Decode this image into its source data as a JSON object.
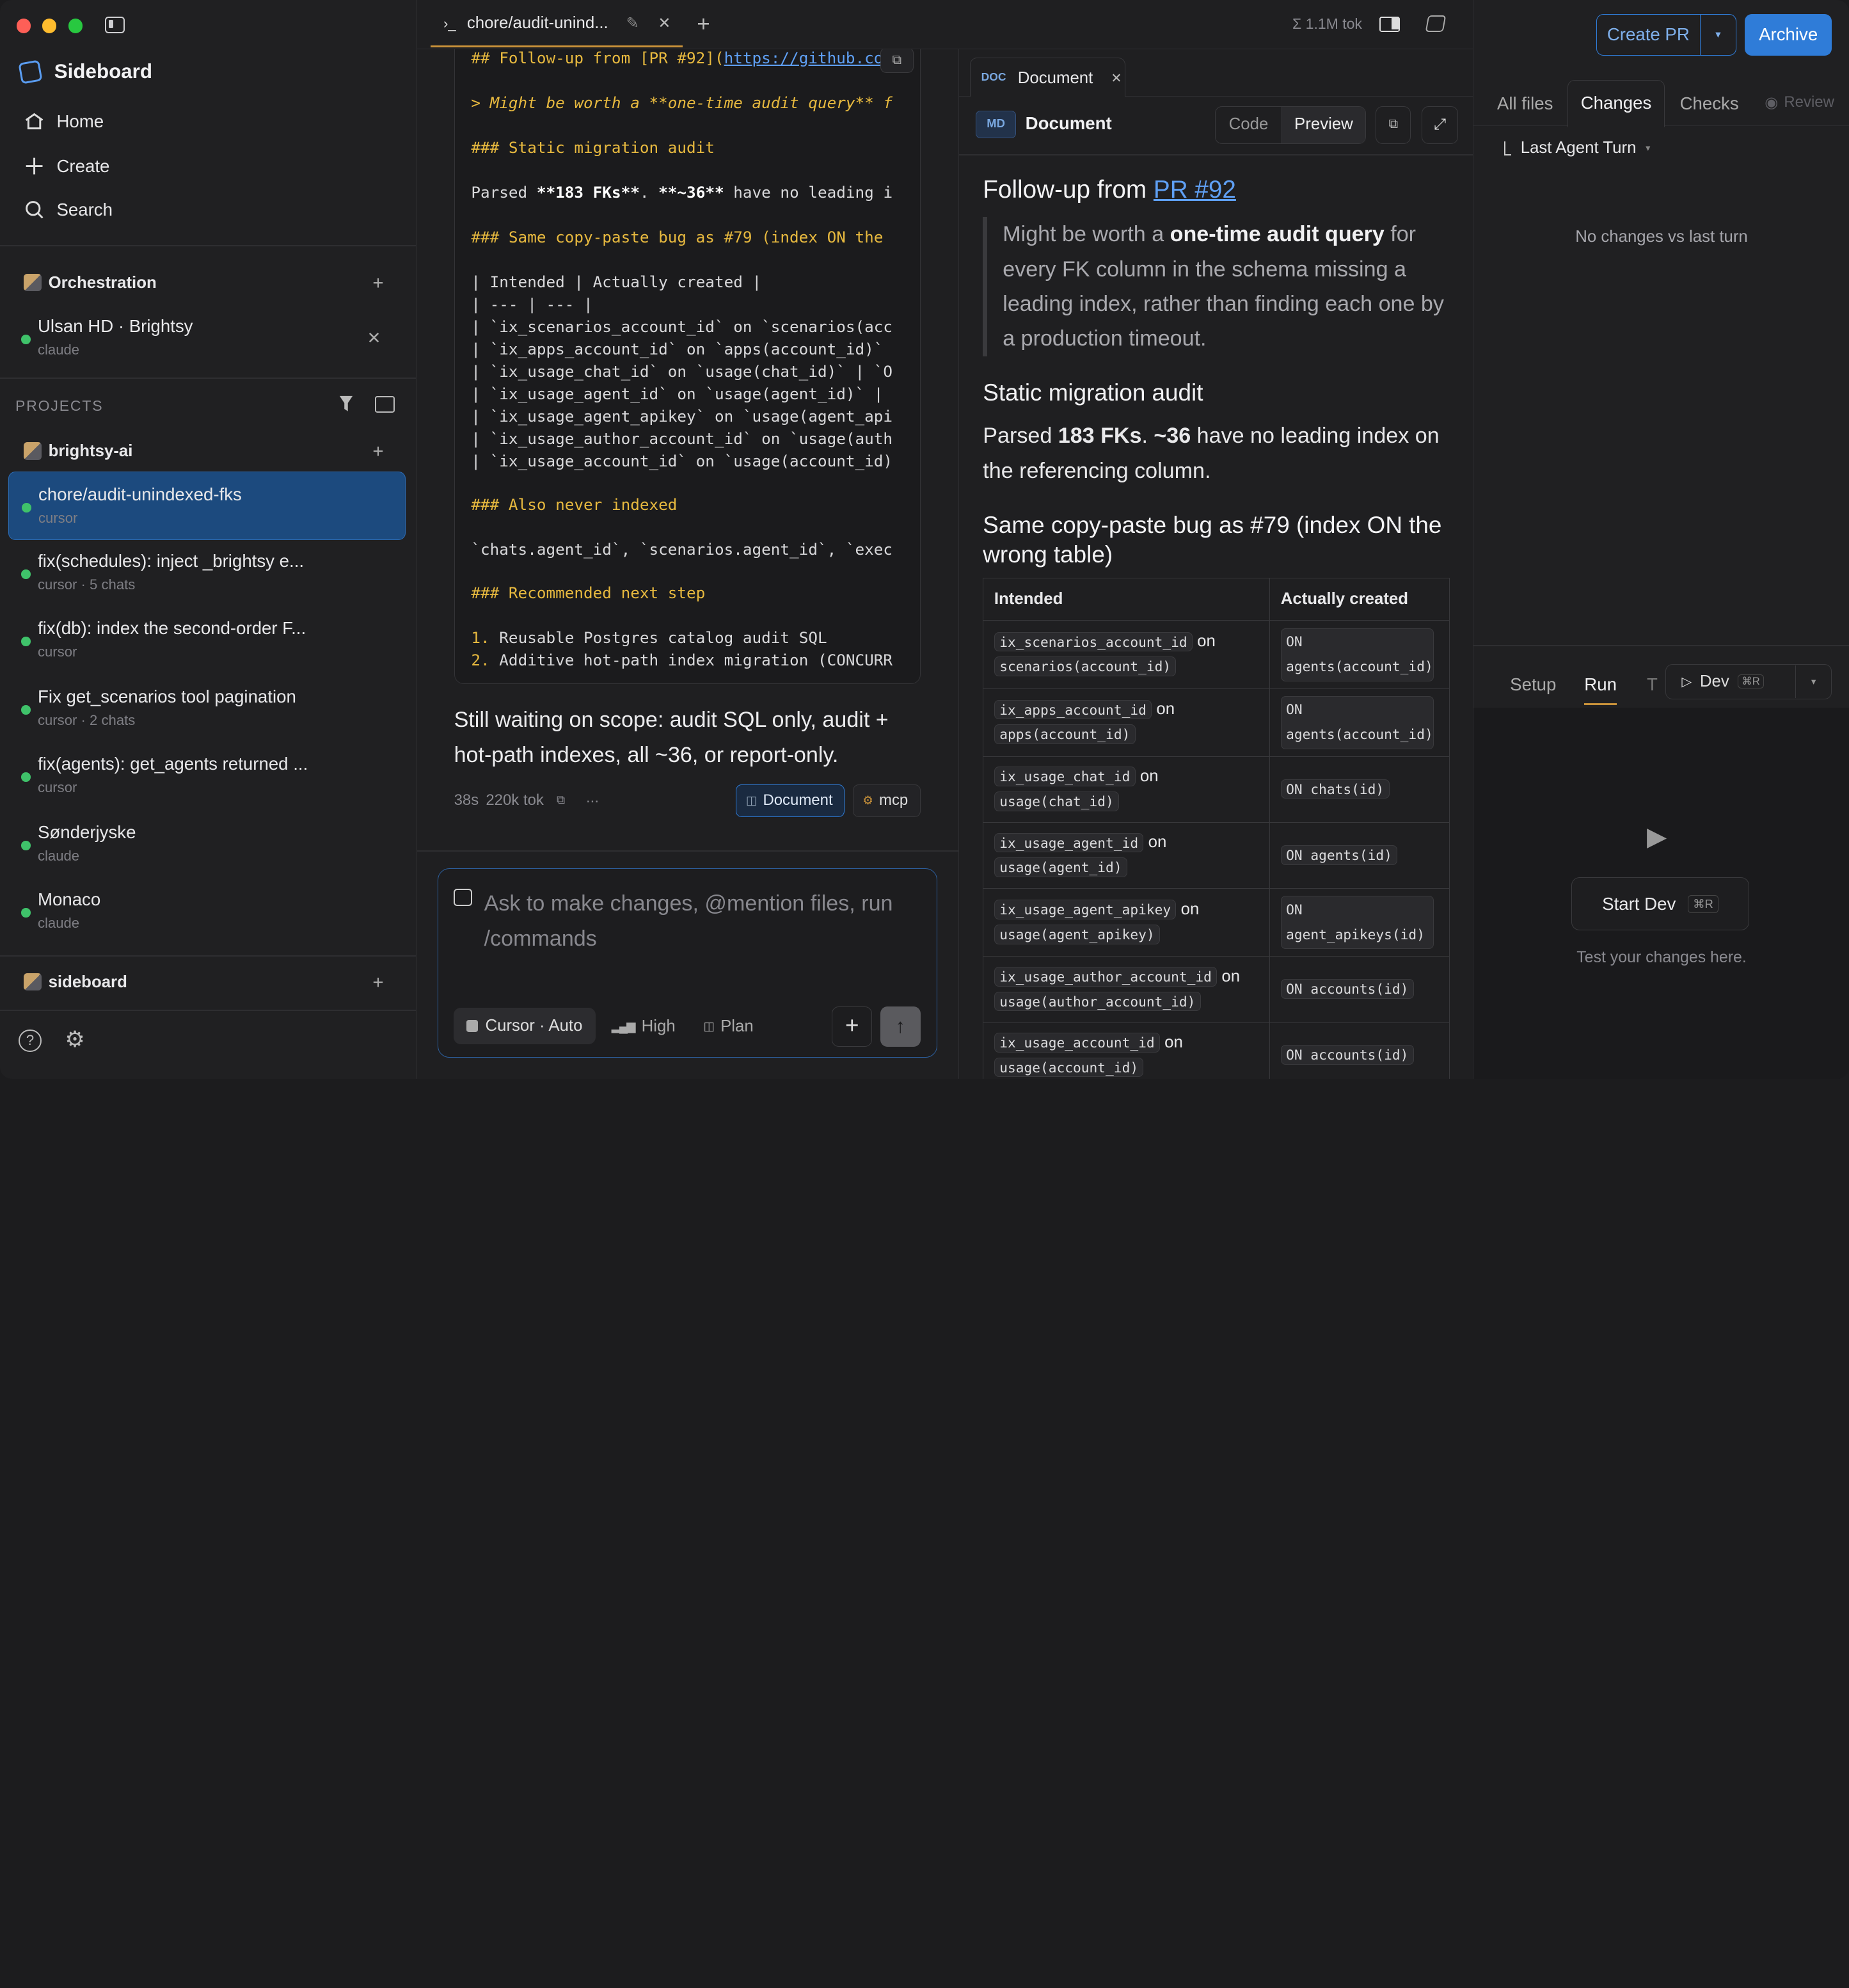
{
  "app": {
    "name": "Sideboard"
  },
  "nav": [
    {
      "label": "Home",
      "icon": "home-icon"
    },
    {
      "label": "Create",
      "icon": "plus-icon"
    },
    {
      "label": "Search",
      "icon": "search-icon"
    }
  ],
  "orchestration": {
    "title": "Orchestration",
    "item": {
      "title": "Ulsan HD · Brightsy",
      "sub": "claude"
    }
  },
  "projects": {
    "header": "PROJECTS",
    "groups": [
      {
        "name": "brightsy-ai",
        "items": [
          {
            "title": "chore/audit-unindexed-fks",
            "sub": "cursor",
            "active": true
          },
          {
            "title": "fix(schedules): inject _brightsy e...",
            "sub": "cursor · 5 chats"
          },
          {
            "title": "fix(db): index the second-order F...",
            "sub": "cursor"
          },
          {
            "title": "Fix get_scenarios tool pagination",
            "sub": "cursor · 2 chats"
          },
          {
            "title": "fix(agents): get_agents returned ...",
            "sub": "cursor"
          },
          {
            "title": "Sønderjyske",
            "sub": "claude"
          },
          {
            "title": "Monaco",
            "sub": "claude"
          }
        ]
      },
      {
        "name": "sideboard",
        "items": []
      }
    ]
  },
  "tab": {
    "prefix": "›_",
    "title": "chore/audit-unind...",
    "tokens": "Σ 1.1M tok"
  },
  "code": {
    "l1a": "## Follow-up from [PR #92](",
    "l1b": "https://github.com",
    "l2": "> Might be worth a **one-time audit query** f",
    "l3": "### Static migration audit",
    "l4a": "Parsed ",
    "l4b": "**183 FKs**",
    ". ": "",
    "l4c": ". ",
    "l4d": "**~36**",
    "l4e": " have no leading i",
    "l5": "### Same copy-paste bug as #79 (index ON the",
    "t1": "| Intended | Actually created |",
    "t2": "| --- | --- |",
    "t3": "| `ix_scenarios_account_id` on `scenarios(acc",
    "t4": "| `ix_apps_account_id` on `apps(account_id)`",
    "t5": "| `ix_usage_chat_id` on `usage(chat_id)` | `O",
    "t6": "| `ix_usage_agent_id` on `usage(agent_id)` |",
    "t7": "| `ix_usage_agent_apikey` on `usage(agent_api",
    "t8": "| `ix_usage_author_account_id` on `usage(auth",
    "t9": "| `ix_usage_account_id` on `usage(account_id)",
    "l6": "### Also never indexed",
    "l7": "`chats.agent_id`, `scenarios.agent_id`, `exec",
    "l8": "### Recommended next step",
    "n1a": "1.",
    "n1b": " Reusable Postgres catalog audit SQL",
    "n2a": "2.",
    "n2b": " Additive hot-path index migration (CONCURR"
  },
  "message": {
    "text": "Still waiting on scope: audit SQL only, audit + hot-path indexes, all ~36, or report-only.",
    "time": "38s",
    "tokens": "220k tok",
    "more": "...",
    "chip_doc": "Document",
    "chip_mcp": "mcp"
  },
  "composer": {
    "placeholder": "Ask to make changes, @mention files, run /commands",
    "model": "Cursor · Auto",
    "effort": "High",
    "mode": "Plan"
  },
  "doc": {
    "tab_badge": "DOC",
    "tab_title": "Document",
    "md_badge": "MD",
    "title": "Document",
    "code_btn": "Code",
    "preview_btn": "Preview",
    "h1a": "Follow-up from ",
    "h1b": "PR #92",
    "quote_a": "Might be worth a ",
    "quote_b": "one-time audit query",
    "quote_c": " for every FK column in the schema missing a leading index, rather than finding each one by a production timeout.",
    "h2": "Static migration audit",
    "p1a": "Parsed ",
    "p1b": "183 FKs",
    "p1c": ". ",
    "p1d": "~36",
    "p1e": " have no leading index on the referencing column.",
    "h3": "Same copy-paste bug as #79 (index ON the wrong table)",
    "th1": "Intended",
    "th2": "Actually created",
    "rows": [
      {
        "a": "ix_scenarios_account_id",
        "on": "on",
        "b": "scenarios(account_id)",
        "c": "ON agents(account_id)"
      },
      {
        "a": "ix_apps_account_id",
        "on": "on",
        "b": "apps(account_id)",
        "c": "ON agents(account_id)"
      },
      {
        "a": "ix_usage_chat_id",
        "on": "on",
        "b": "usage(chat_id)",
        "c": "ON chats(id)"
      },
      {
        "a": "ix_usage_agent_id",
        "on": "on",
        "b": "usage(agent_id)",
        "c": "ON agents(id)"
      },
      {
        "a": "ix_usage_agent_apikey",
        "on": "on",
        "b": "usage(agent_apikey)",
        "c": "ON agent_apikeys(id)"
      },
      {
        "a": "ix_usage_author_account_id",
        "on": "on",
        "b": "usage(author_account_id)",
        "c": "ON accounts(id)"
      },
      {
        "a": "ix_usage_account_id",
        "on": "on",
        "b": "usage(account_id)",
        "c": "ON accounts(id)"
      }
    ]
  },
  "right": {
    "create_pr": "Create PR",
    "archive": "Archive",
    "tabs": [
      "All files",
      "Changes",
      "Checks",
      "Review"
    ],
    "last_turn": "Last Agent Turn",
    "empty": "No changes vs last turn",
    "run_tabs": [
      "Setup",
      "Run",
      "T"
    ],
    "dev": "Dev",
    "dev_kbd": "⌘R",
    "start_dev": "Start Dev",
    "start_kbd": "⌘R",
    "hint": "Test your changes here."
  },
  "colors": {
    "accent": "#2f7cd8",
    "active_item": "#1c4a7e",
    "green": "#3fc26a",
    "code_heading": "#e7b93f"
  }
}
